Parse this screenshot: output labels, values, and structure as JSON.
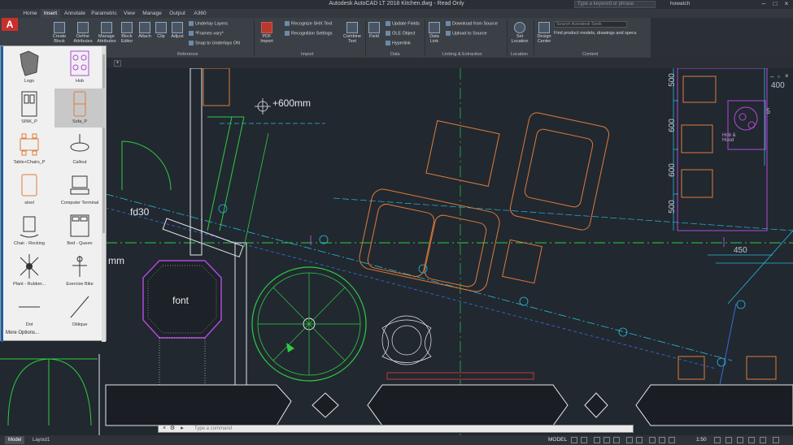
{
  "titlebar": {
    "app_title": "Autodesk AutoCAD LT 2018   Kitchen.dwg - Read Only",
    "search_placeholder": "Type a keyword or phrase",
    "user": "howatch"
  },
  "ribbon": {
    "tabs": [
      "Home",
      "Insert",
      "Annotate",
      "Parametric",
      "View",
      "Manage",
      "Output",
      "A360"
    ],
    "active_tab": "Insert",
    "block_buttons": [
      "Create Block",
      "Define Attributes",
      "Manage Attributes",
      "Block Editor"
    ],
    "reference_buttons": [
      "Attach",
      "Clip",
      "Adjust"
    ],
    "reference_small": [
      "Underlay Layers",
      "*Frames vary*",
      "Snap to Underlays ON"
    ],
    "panel_reference": "Reference",
    "pdf_import": "PDF Import",
    "import_small": [
      "Recognize SHX Text",
      "Recognition Settings"
    ],
    "combine_text": "Combine Text",
    "panel_import": "Import",
    "field": "Field",
    "data_small": [
      "Update Fields",
      "OLE Object",
      "Hyperlink"
    ],
    "panel_data": "Data",
    "data_link": "Data Link",
    "linking_small": [
      "Download from Source",
      "Upload to Source"
    ],
    "panel_linking": "Linking & Extraction",
    "set_location": "Set Location",
    "panel_location": "Location",
    "design_center": "Design Center",
    "content_search_placeholder": "Search Autodesk Seek",
    "content_hint": "Find product models, drawings and specs",
    "panel_content": "Content"
  },
  "palette": {
    "items": [
      "Logo",
      "Hob",
      "SINK_P",
      "Sofa_P",
      "Table+Chairs_P",
      "Callout",
      "stool",
      "Computer Terminal",
      "Chair - Rocking",
      "Bed - Queen",
      "Plant - Rubber...",
      "Exercise Bike",
      "Dot",
      "Oblique"
    ],
    "selected": "Sofa_P",
    "more_options": "More Options..."
  },
  "drawing": {
    "dim_600mm": "+600mm",
    "label_fd30": "fd30",
    "label_mm": "mm",
    "label_font": "font",
    "dim_500a": "500",
    "dim_600a": "600",
    "dim_600b": "600",
    "dim_500b": "500",
    "dim_450": "450",
    "dim_400": "400",
    "hob_label": "Hob &\nHood",
    "dim_5": "5"
  },
  "cmdline": {
    "placeholder": "Type a command"
  },
  "statusbar": {
    "tabs": [
      "Model",
      "Layout1"
    ],
    "active_tab": "Model",
    "model_label": "MODEL",
    "scale": "1:50"
  },
  "colors": {
    "orange": "#e07b39",
    "green": "#2ecc40",
    "cyan": "#2bb8d8",
    "purple": "#b04ad8",
    "white": "#e8e8e8",
    "blue": "#3a6ed8",
    "red": "#c43a3a"
  }
}
